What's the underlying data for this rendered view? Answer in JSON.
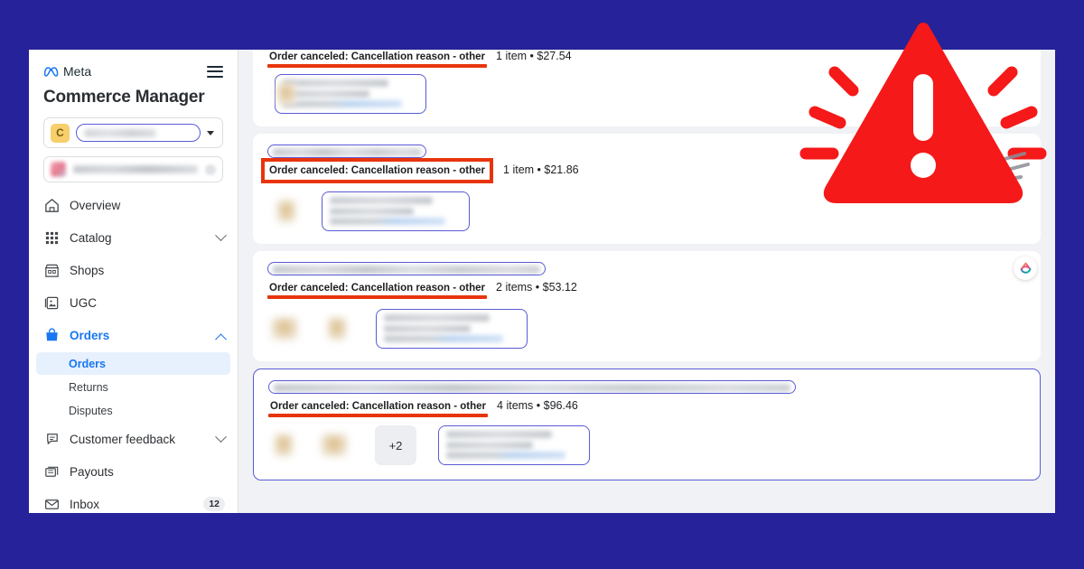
{
  "window": {
    "background_color": "#262299",
    "panel_background": "#f0f2f5"
  },
  "sidebar": {
    "brand": "Meta",
    "app_title": "Commerce Manager",
    "menu_icon": "hamburger-icon",
    "account": {
      "avatar_letter": "C",
      "avatar_color": "#f7cf6b",
      "name_redacted": "",
      "caret_icon": "caret-down-icon"
    },
    "search": {
      "value": "",
      "placeholder": "",
      "clear_icon": "close-circle-icon"
    },
    "items": [
      {
        "label": "Overview",
        "icon": "home-icon",
        "expandable": false,
        "active": false
      },
      {
        "label": "Catalog",
        "icon": "grid-icon",
        "expandable": true,
        "active": false
      },
      {
        "label": "Shops",
        "icon": "storefront-icon",
        "expandable": false,
        "active": false
      },
      {
        "label": "UGC",
        "icon": "image-frame-icon",
        "expandable": false,
        "active": false
      },
      {
        "label": "Orders",
        "icon": "bag-icon",
        "expandable": true,
        "active": true
      }
    ],
    "order_subitems": [
      {
        "label": "Orders",
        "active": true
      },
      {
        "label": "Returns",
        "active": false
      },
      {
        "label": "Disputes",
        "active": false
      }
    ],
    "items_after": [
      {
        "label": "Customer feedback",
        "icon": "speech-bubble-icon",
        "expandable": true,
        "badge": ""
      },
      {
        "label": "Payouts",
        "icon": "cash-stack-icon",
        "expandable": false,
        "badge": ""
      },
      {
        "label": "Inbox",
        "icon": "envelope-icon",
        "expandable": false,
        "badge": "12"
      }
    ],
    "accent_color": "#1877f2",
    "active_bg": "#e7f0fd"
  },
  "orders": [
    {
      "status": "Order canceled: Cancellation reason - other",
      "meta": "1 item • $27.54",
      "items_count": 1,
      "amount": "$27.54",
      "highlight": "underline",
      "highlight_color": "#e8340c",
      "selected": false,
      "has_title_bar": false,
      "extra_thumbs": 0,
      "plus_badge": ""
    },
    {
      "status": "Order canceled: Cancellation reason - other",
      "meta": "1 item • $21.86",
      "items_count": 1,
      "amount": "$21.86",
      "highlight": "boxed",
      "highlight_color": "#e8340c",
      "selected": false,
      "has_title_bar": true,
      "extra_thumbs": 1,
      "plus_badge": ""
    },
    {
      "status": "Order canceled: Cancellation reason - other",
      "meta": "2 items • $53.12",
      "items_count": 2,
      "amount": "$53.12",
      "highlight": "underline",
      "highlight_color": "#e8340c",
      "selected": false,
      "has_title_bar": true,
      "extra_thumbs": 2,
      "plus_badge": ""
    },
    {
      "status": "Order canceled: Cancellation reason - other",
      "meta": "4 items • $96.46",
      "items_count": 4,
      "amount": "$96.46",
      "highlight": "underline",
      "highlight_color": "#e8340c",
      "selected": true,
      "has_title_bar": true,
      "extra_thumbs": 2,
      "plus_badge": "+2"
    }
  ],
  "meta_ai_badge": {
    "icon": "meta-ai-icon"
  },
  "overlay": {
    "icon": "warning-triangle-icon",
    "color": "#f51919",
    "mark": "!"
  }
}
